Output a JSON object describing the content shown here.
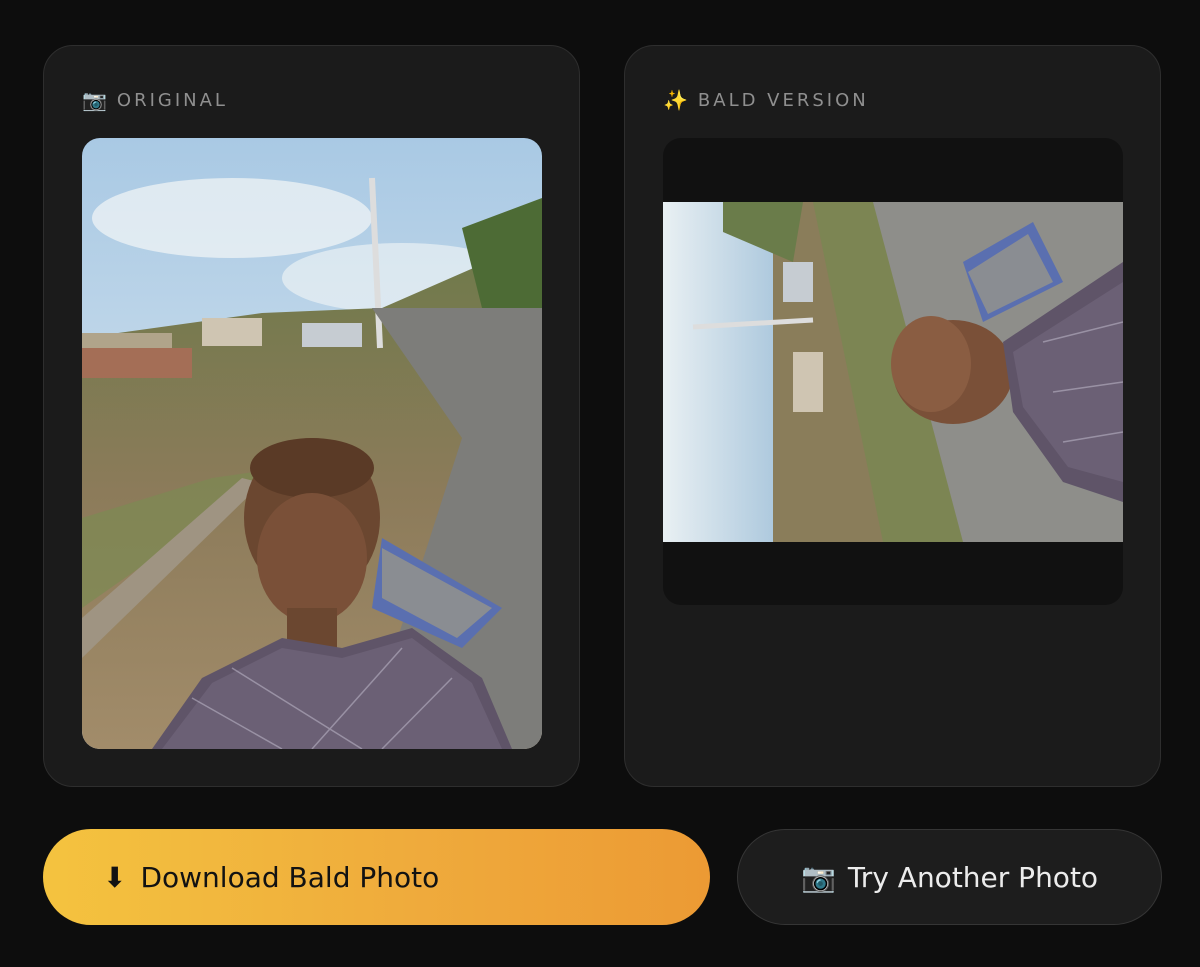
{
  "original_card": {
    "icon": "camera-icon",
    "label": "ORIGINAL"
  },
  "result_card": {
    "icon": "sparkles-icon",
    "label": "BALD VERSION"
  },
  "actions": {
    "download": {
      "icon": "download-arrow-icon",
      "label": "Download Bald Photo"
    },
    "try_another": {
      "icon": "camera-icon",
      "label": "Try Another Photo"
    }
  },
  "colors": {
    "background": "#0d0d0d",
    "card": "#1b1b1b",
    "accent_gradient_start": "#f4c33f",
    "accent_gradient_end": "#ec9a34"
  }
}
